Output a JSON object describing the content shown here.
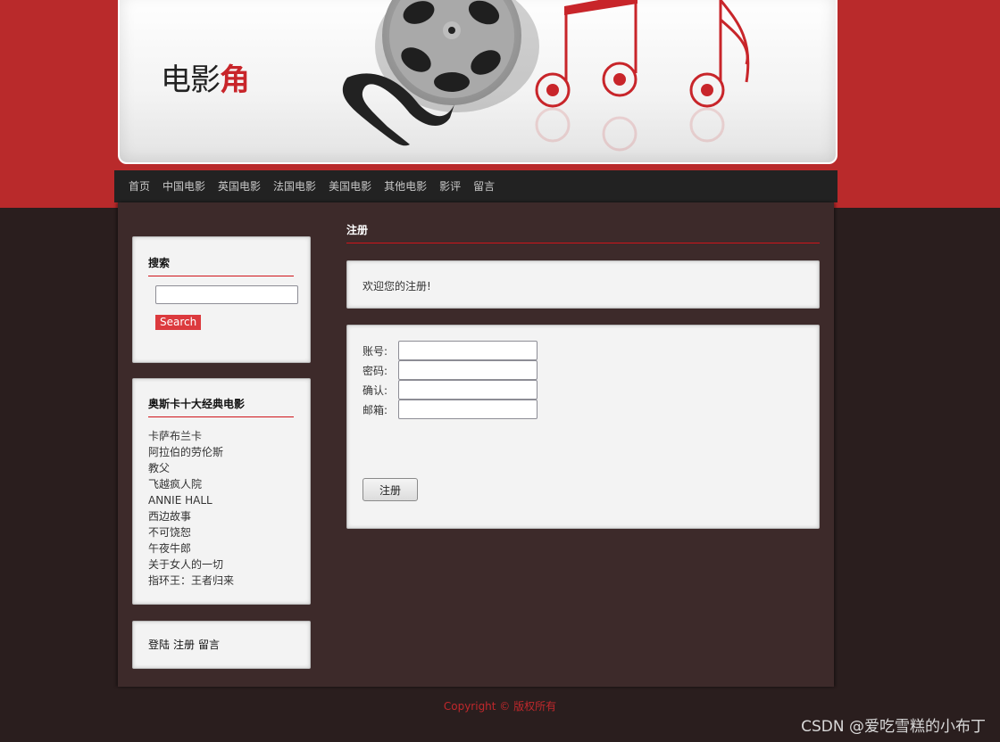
{
  "site": {
    "logo_main": "电影",
    "logo_accent": "角"
  },
  "colors": {
    "brand_red": "#b92a2b",
    "accent_red": "#c8252a",
    "nav_bg": "#222222",
    "content_bg": "#3d2a2a",
    "page_bg": "#2a1e1e"
  },
  "nav": {
    "items": [
      {
        "label": "首页"
      },
      {
        "label": "中国电影"
      },
      {
        "label": "英国电影"
      },
      {
        "label": "法国电影"
      },
      {
        "label": "美国电影"
      },
      {
        "label": "其他电影"
      },
      {
        "label": "影评"
      },
      {
        "label": "留言"
      }
    ]
  },
  "sidebar": {
    "search": {
      "title": "搜索",
      "input_value": "",
      "button_label": "Search"
    },
    "oscar": {
      "title": "奥斯卡十大经典电影",
      "movies": [
        "卡萨布兰卡",
        "阿拉伯的劳伦斯",
        "教父",
        "飞越疯人院",
        "ANNIE HALL",
        "西边故事",
        "不可饶恕",
        "午夜牛郎",
        "关于女人的一切",
        "指环王：王者归来"
      ]
    },
    "links": {
      "login": "登陆",
      "register": "注册",
      "message": "留言"
    }
  },
  "main": {
    "title": "注册",
    "welcome": "欢迎您的注册!",
    "form": {
      "account_label": "账号:",
      "account_value": "",
      "password_label": "密码:",
      "password_value": "",
      "confirm_label": "确认:",
      "confirm_value": "",
      "email_label": "邮箱:",
      "email_value": "",
      "submit_label": "注册"
    }
  },
  "footer": {
    "copyright": "Copyright © 版权所有"
  },
  "watermark": "CSDN @爱吃雪糕的小布丁"
}
